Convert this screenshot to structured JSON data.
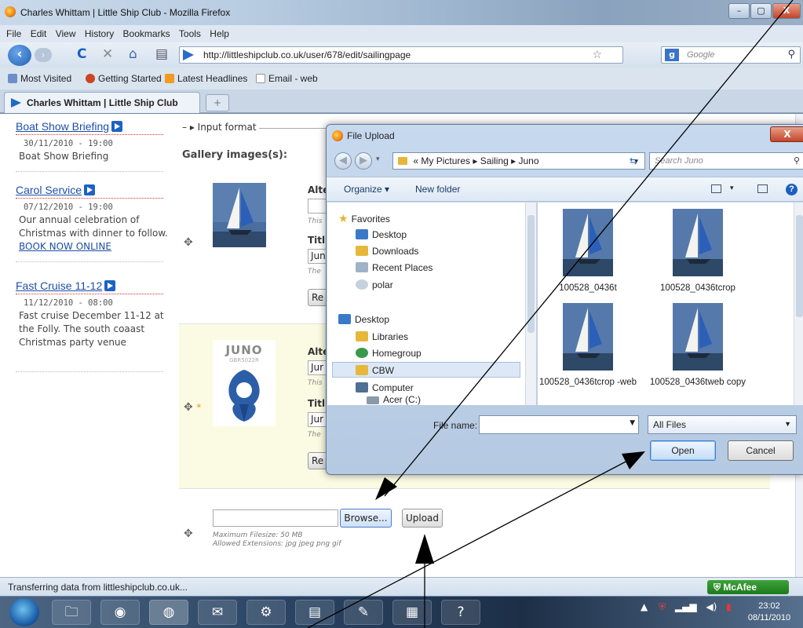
{
  "window": {
    "title": "Charles Whittam | Little Ship Club - Mozilla Firefox",
    "min": "–",
    "max": "▢",
    "close": "X"
  },
  "menu": [
    "File",
    "Edit",
    "View",
    "History",
    "Bookmarks",
    "Tools",
    "Help"
  ],
  "nav": {
    "url": "http://littleshipclub.co.uk/user/678/edit/sailingpage",
    "search_placeholder": "Google"
  },
  "bookmarks": [
    "Most Visited",
    "Getting Started",
    "Latest Headlines",
    "Email - web"
  ],
  "tab": {
    "label": "Charles Whittam | Little Ship Club",
    "new": "+"
  },
  "sidebar": {
    "events": [
      {
        "title": "Boat Show Briefing",
        "date": "30/11/2010 - 19:00",
        "desc": "Boat Show Briefing",
        "link": ""
      },
      {
        "title": "Carol Service",
        "date": "07/12/2010 - 19:00",
        "desc": "Our annual celebration of Christmas with dinner to follow.",
        "link": "BOOK NOW ONLINE"
      },
      {
        "title": "Fast Cruise 11-12",
        "date": "11/12/2010 - 08:00",
        "desc": "Fast cruise December 11-12 at the Folly. The south coaast Christmas party venue",
        "link": ""
      }
    ]
  },
  "main": {
    "input_format": "Input format",
    "gallery_label": "Gallery images(s):",
    "rows": [
      {
        "alt_label": "Alte",
        "alt_value": "",
        "alt_hint": "This",
        "title_label": "Titl",
        "title_value": "Jun",
        "title_hint": "The",
        "remove": "Re",
        "marker": ""
      },
      {
        "alt_label": "Alte",
        "alt_value": "Jur",
        "alt_hint": "This",
        "title_label": "Titl",
        "title_value": "Jur",
        "title_hint": "The",
        "remove": "Re",
        "marker": "*"
      }
    ],
    "logo_text": "JUNO",
    "logo_sub": "GBR5022R",
    "browse": "Browse...",
    "upload": "Upload",
    "max_filesize": "Maximum Filesize: 50 MB",
    "allowed_ext": "Allowed Extensions: jpg jpeg png gif"
  },
  "status": {
    "text": "Transferring data from littleshipclub.co.uk...",
    "mcafee": "McAfee"
  },
  "taskbar": {
    "time": "23:02",
    "date": "08/11/2010"
  },
  "dialog": {
    "title": "File Upload",
    "close": "X",
    "path": [
      "«",
      "My Pictures",
      "Sailing",
      "Juno"
    ],
    "search_placeholder": "Search Juno",
    "organize": "Organize ▾",
    "new_folder": "New folder",
    "tree": {
      "favorites": "Favorites",
      "fav_items": [
        "Desktop",
        "Downloads",
        "Recent Places",
        "polar"
      ],
      "desktop": "Desktop",
      "desk_items": [
        "Libraries",
        "Homegroup",
        "CBW",
        "Computer",
        "Acer (C:)"
      ]
    },
    "files": [
      "100528_0436t",
      "100528_0436tcrop",
      "100528_0436tcrop -web",
      "100528_0436tweb copy"
    ],
    "file_name_label": "File name:",
    "file_name_value": "",
    "filter": "All Files",
    "open": "Open",
    "cancel": "Cancel"
  }
}
